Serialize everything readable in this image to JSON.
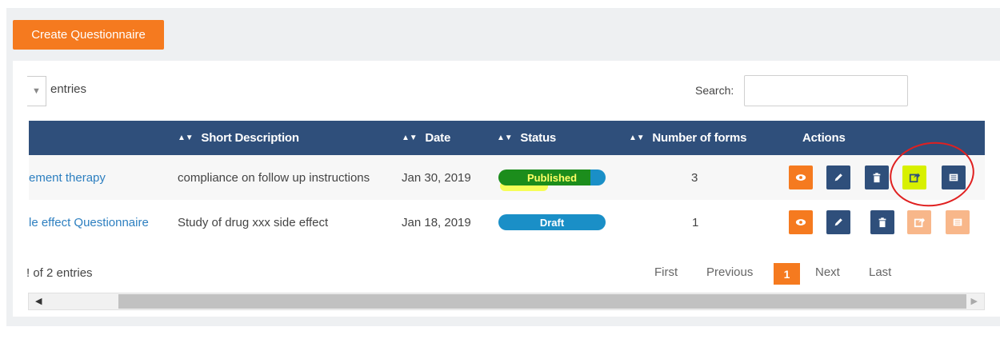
{
  "toolbar": {
    "create_label": "Create Questionnaire"
  },
  "table_controls": {
    "length_arrow": "▼",
    "entries_label": "entries",
    "search_label": "Search:",
    "search_value": ""
  },
  "headers": {
    "short_description": "Short Description",
    "date": "Date",
    "status": "Status",
    "number_of_forms": "Number of forms",
    "actions": "Actions",
    "sort_glyph": "▲▼"
  },
  "rows": [
    {
      "name": "ement therapy",
      "description": "compliance on follow up instructions",
      "date": "Jan 30, 2019",
      "status": "Published",
      "forms": "3"
    },
    {
      "name": "le effect Questionnaire",
      "description": "Study of drug xxx side effect",
      "date": "Jan 18, 2019",
      "status": "Draft",
      "forms": "1"
    }
  ],
  "footer": {
    "info": "! of 2 entries",
    "first": "First",
    "previous": "Previous",
    "current_page": "1",
    "next": "Next",
    "last": "Last"
  },
  "scroll": {
    "left": "◀",
    "right": "▶"
  },
  "colors": {
    "accent_orange": "#f57a1f",
    "header_navy": "#2f4f7b",
    "link_blue": "#2d7fc0",
    "status_blue": "#1a8fc7",
    "published_green": "#1c8d1c",
    "annotation_red": "#e02020"
  },
  "icons": [
    "eye-icon",
    "pencil-icon",
    "trash-icon",
    "share-icon",
    "list-icon"
  ]
}
